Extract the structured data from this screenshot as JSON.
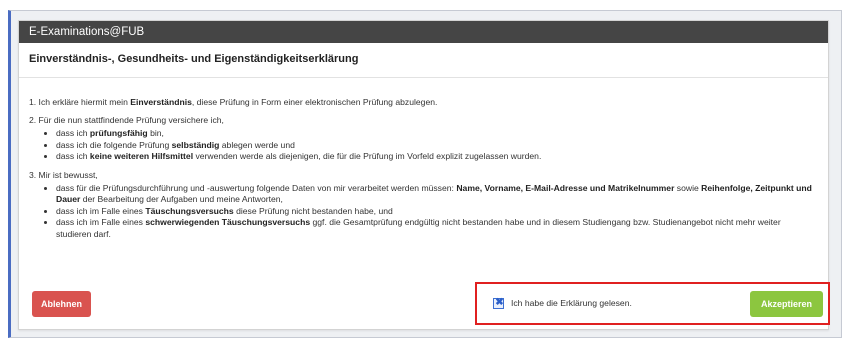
{
  "header": {
    "title": "E-Examinations@FUB"
  },
  "dialog": {
    "title": "Einverständnis-, Gesundheits- und Eigenständigkeitserklärung"
  },
  "content": {
    "p1": {
      "a": "1. Ich erkläre hiermit mein ",
      "b": "Einverständnis",
      "c": ", diese Prüfung in Form einer elektronischen Prüfung abzulegen."
    },
    "p2": {
      "text": "2. Für die nun stattfindende Prüfung versichere ich,"
    },
    "p2_items": [
      {
        "a": "dass ich ",
        "b": "prüfungsfähig",
        "c": " bin,"
      },
      {
        "a": "dass ich die folgende Prüfung ",
        "b": "selbständig",
        "c": " ablegen werde und"
      },
      {
        "a": "dass ich ",
        "b": "keine weiteren Hilfsmittel",
        "c": " verwenden werde als diejenigen, die für die Prüfung im Vorfeld explizit zugelassen wurden."
      }
    ],
    "p3": {
      "text": "3. Mir ist bewusst,"
    },
    "p3_items": [
      {
        "a": "dass für die Prüfungsdurchführung und -auswertung folgende Daten von mir verarbeitet werden müssen: ",
        "b": "Name, Vorname, E-Mail-Adresse und Matrikelnummer",
        "c": " sowie ",
        "d": "Reihenfolge, Zeitpunkt und Dauer",
        "e": " der Bearbeitung der Aufgaben und meine Antworten,"
      },
      {
        "a": "dass ich im Falle eines ",
        "b": "Täuschungsversuchs",
        "c": " diese Prüfung nicht bestanden habe, und"
      },
      {
        "a": "dass ich im Falle eines ",
        "b": "schwerwiegenden Täuschungsversuchs",
        "c": " ggf. die Gesamtprüfung endgültig nicht bestanden habe und in diesem Studiengang bzw. Studienangebot nicht mehr weiter studieren darf."
      }
    ]
  },
  "footer": {
    "decline_label": "Ablehnen",
    "accept_label": "Akzeptieren",
    "checkbox_label": "Ich habe die Erklärung gelesen.",
    "checkbox_checked": true
  },
  "colors": {
    "header_bg": "#454545",
    "decline": "#d9534f",
    "accept": "#8cc63f",
    "highlight": "#e02020"
  }
}
